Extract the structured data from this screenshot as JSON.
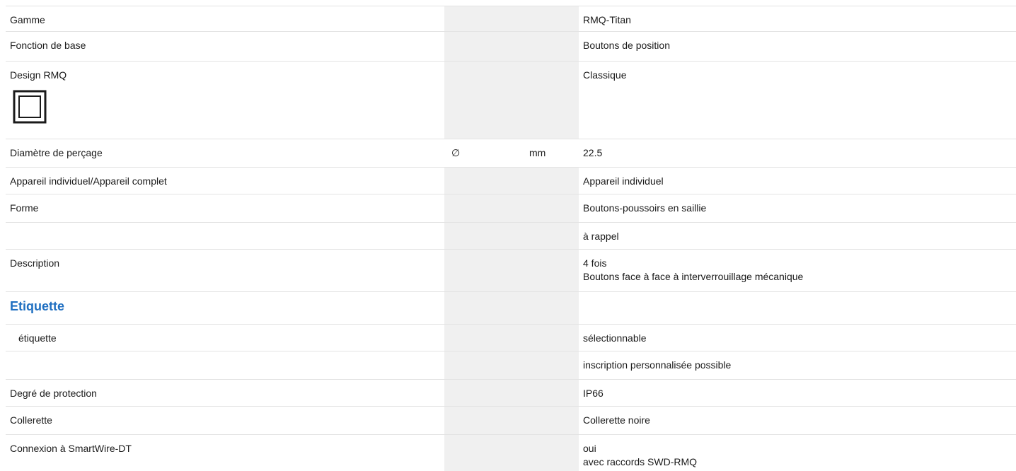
{
  "rows": [
    {
      "label": "Gamme",
      "value": "RMQ-Titan"
    },
    {
      "label": "Fonction de base",
      "value": "Boutons de position"
    },
    {
      "label": "Design RMQ",
      "value": "Classique",
      "icon": "rmq-classic-design-icon"
    },
    {
      "label": "Diamètre de perçage",
      "symbol": "∅",
      "unit": "mm",
      "value": "22.5"
    },
    {
      "label": "Appareil individuel/Appareil complet",
      "value": "Appareil individuel"
    },
    {
      "label": "Forme",
      "value": "Boutons-poussoirs en saillie"
    },
    {
      "label": "",
      "value": "à rappel"
    },
    {
      "label": "Description",
      "value_lines": [
        "4 fois",
        "Boutons face à face à interverrouillage mécanique"
      ]
    },
    {
      "section": "Etiquette"
    },
    {
      "label": "étiquette",
      "value": "sélectionnable"
    },
    {
      "label": "",
      "value": "inscription personnalisée possible"
    },
    {
      "label": "Degré de protection",
      "value": "IP66"
    },
    {
      "label": "Collerette",
      "value": "Collerette noire"
    },
    {
      "label": "Connexion à SmartWire-DT",
      "value_lines": [
        "oui",
        "avec raccords SWD-RMQ"
      ]
    }
  ],
  "colors": {
    "section_heading": "#1f6fc1",
    "shaded_column": "#f0f0f0",
    "divider": "#e3e3e3"
  }
}
